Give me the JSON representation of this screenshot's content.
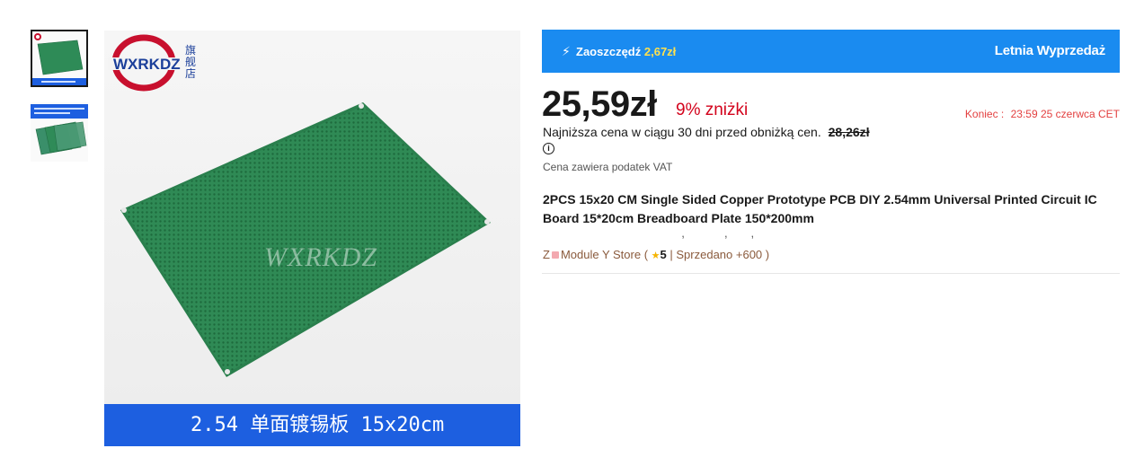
{
  "gallery": {
    "thumbnails": [
      {
        "name": "thumbnail-1",
        "caption": "2.54 单面镀锡板 15x20cm",
        "selected": true
      },
      {
        "name": "thumbnail-2",
        "caption": "2.54 单面镀锡板 5PC 2PC 1PC",
        "selected": false
      }
    ],
    "brand_logo_text": "WXRKDZ",
    "brand_logo_cn": "旗舰店",
    "watermark": "WXRKDZ",
    "caption": "2.54 单面镀锡板 15x20cm"
  },
  "promo": {
    "bolt_icon": "lightning-icon",
    "save_label": "Zaoszczędź",
    "save_amount": "2,67zł",
    "event": "Letnia Wyprzedaż",
    "color": "#1a8bf0"
  },
  "pricing": {
    "price": "25,59zł",
    "discount": "9% zniżki",
    "deadline_label": "Koniec :",
    "deadline_value": "23:59 25 czerwca CET",
    "lowest_label": "Najniższa cena w ciągu 30 dni przed obniżką cen.",
    "lowest_old_price": "28,26zł",
    "info_icon": "i",
    "vat_note": "Cena zawiera podatek VAT"
  },
  "product": {
    "title": "2PCS 15x20 CM Single Sided Copper Prototype PCB DIY 2.54mm Universal Printed Circuit IC Board 15*20cm Breadboard Plate 150*200mm"
  },
  "store": {
    "prefix": "Z",
    "name": "Module Y Store (",
    "rating": "5",
    "sold": "| Sprzedano +600 )"
  }
}
